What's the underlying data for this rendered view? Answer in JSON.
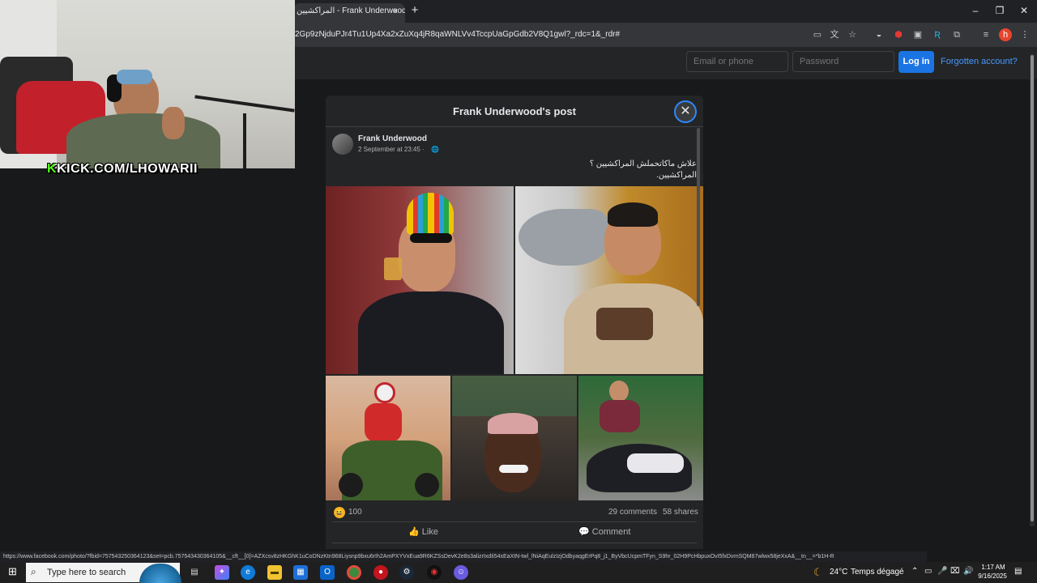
{
  "browser": {
    "tab_title": "المراكشيين - Frank Underwood",
    "tab_close": "×",
    "new_tab": "+",
    "url": "2Gp9zNjduPJr4Tu1Up4Xa2xZuXq4jR8qaWNLVv4TccpUaGpGdb2V8Q1gwl?_rdc=1&_rdr#",
    "window_controls": {
      "minimize": "–",
      "restore": "❐",
      "close": "✕"
    },
    "status_url": "https://www.facebook.com/photo/?fbid=757543250364123&set=pcb.757543430364105&__cft__[0]=AZXcsv8zHKGhK1uCoDNzKtn968Liysnp9bxu6rIh2AmPXYVxEua9R6KZSsDevK2e8s3alizrIxdIi54xEaXtN-twl_lNiAqEulzIzjOdbyaqgErPq8_j1_ByVbcUcpmTFyn_S9hr_02H9PcHbpuxOvI5fxDvrnSQM87wlwx58jeXxA&__tn__=*b1H-R"
  },
  "fb_header": {
    "email_placeholder": "Email or phone",
    "password_placeholder": "Password",
    "login_label": "Log in",
    "forgot_label": "Forgotten account?"
  },
  "post": {
    "modal_title": "Frank Underwood's post",
    "close_icon": "✕",
    "author": "Frank Underwood",
    "date": "2 September at 23:45 ·",
    "globe_icon": "🌐",
    "text_line1": "علاش ماكاتحملش المراكشيين ؟",
    "text_line2": "المراكشيين.",
    "reaction_icon": "😆",
    "reactions_count": "100",
    "comments_count": "29 comments",
    "shares_count": "58 shares",
    "like_label": "Like",
    "comment_label": "Comment",
    "like_icon": "👍",
    "comment_icon": "💬"
  },
  "webcam": {
    "k": "K",
    "text": "KICK.COM/LHOWARII"
  },
  "taskbar": {
    "search_placeholder": "Type here to search",
    "temperature": "24°C",
    "weather": "Temps dégagé",
    "time": "1:17 AM",
    "date": "9/16/2025"
  }
}
